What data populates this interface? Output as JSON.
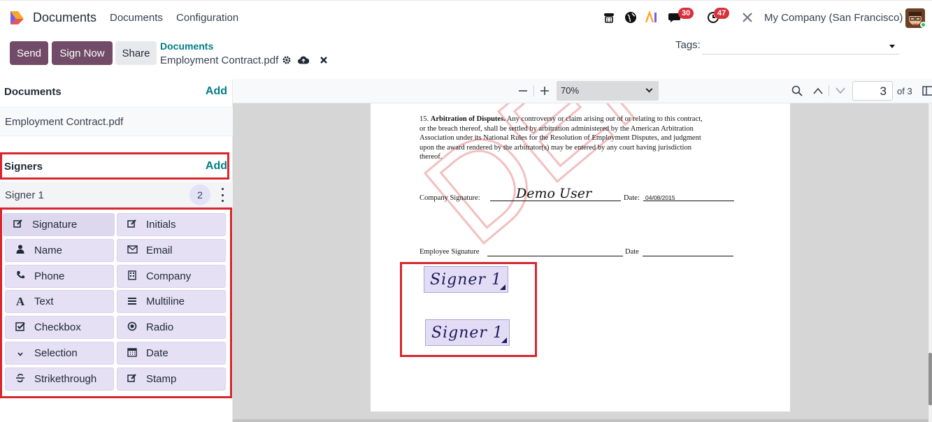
{
  "navbar": {
    "app_name": "Documents",
    "menus": [
      "Documents",
      "Configuration"
    ],
    "messages_count": "30",
    "activities_count": "47",
    "company": "My Company (San Francisco)"
  },
  "control_panel": {
    "send_label": "Send",
    "sign_now_label": "Sign Now",
    "share_label": "Share",
    "breadcrumb": "Documents",
    "record_name": "Employment Contract.pdf",
    "tags_label": "Tags:"
  },
  "left_panel": {
    "documents_title": "Documents",
    "documents_add": "Add",
    "document_name": "Employment Contract.pdf",
    "signers_title": "Signers",
    "signers_add": "Add",
    "signer_name": "Signer 1",
    "signer_field_count": "2",
    "fields": [
      {
        "label": "Signature",
        "icon": "edit-icon"
      },
      {
        "label": "Initials",
        "icon": "edit-icon"
      },
      {
        "label": "Name",
        "icon": "user-icon"
      },
      {
        "label": "Email",
        "icon": "envelope-icon"
      },
      {
        "label": "Phone",
        "icon": "phone-icon"
      },
      {
        "label": "Company",
        "icon": "building-icon"
      },
      {
        "label": "Text",
        "icon": "font-icon"
      },
      {
        "label": "Multiline",
        "icon": "bars-icon"
      },
      {
        "label": "Checkbox",
        "icon": "check-square-icon"
      },
      {
        "label": "Radio",
        "icon": "dot-circle-icon"
      },
      {
        "label": "Selection",
        "icon": "chevron-down-icon"
      },
      {
        "label": "Date",
        "icon": "calendar-icon"
      },
      {
        "label": "Strikethrough",
        "icon": "strikethrough-icon"
      },
      {
        "label": "Stamp",
        "icon": "edit-icon"
      }
    ]
  },
  "viewer": {
    "zoom": "70%",
    "page_number": "3",
    "page_total": "of 3"
  },
  "pdf": {
    "clause_number": "15.",
    "clause_title": "Arbitration of Disputes.",
    "clause_line1": " Any controversy or claim arising out of or relating to this contract,",
    "clause_line2": "or the breach thereof, shall be settled by arbitration administered by the American Arbitration",
    "clause_line3": "Association under its National Rules for the Resolution of Employment Disputes, and judgment",
    "clause_line4": "upon the award rendered by the arbitrator(s) may be entered by any court having jurisdiction",
    "clause_line5": "thereof.",
    "company_sig_label": "Company Signature:",
    "company_sig_value": "Demo User",
    "date_label": "Date:",
    "date_value": "04/08/2015",
    "employee_sig_label": "Employee Signature",
    "employee_date_label": "Date",
    "watermark": "DEMO",
    "signer_field_1": "Signer 1",
    "signer_field_2": "Signer 1"
  }
}
